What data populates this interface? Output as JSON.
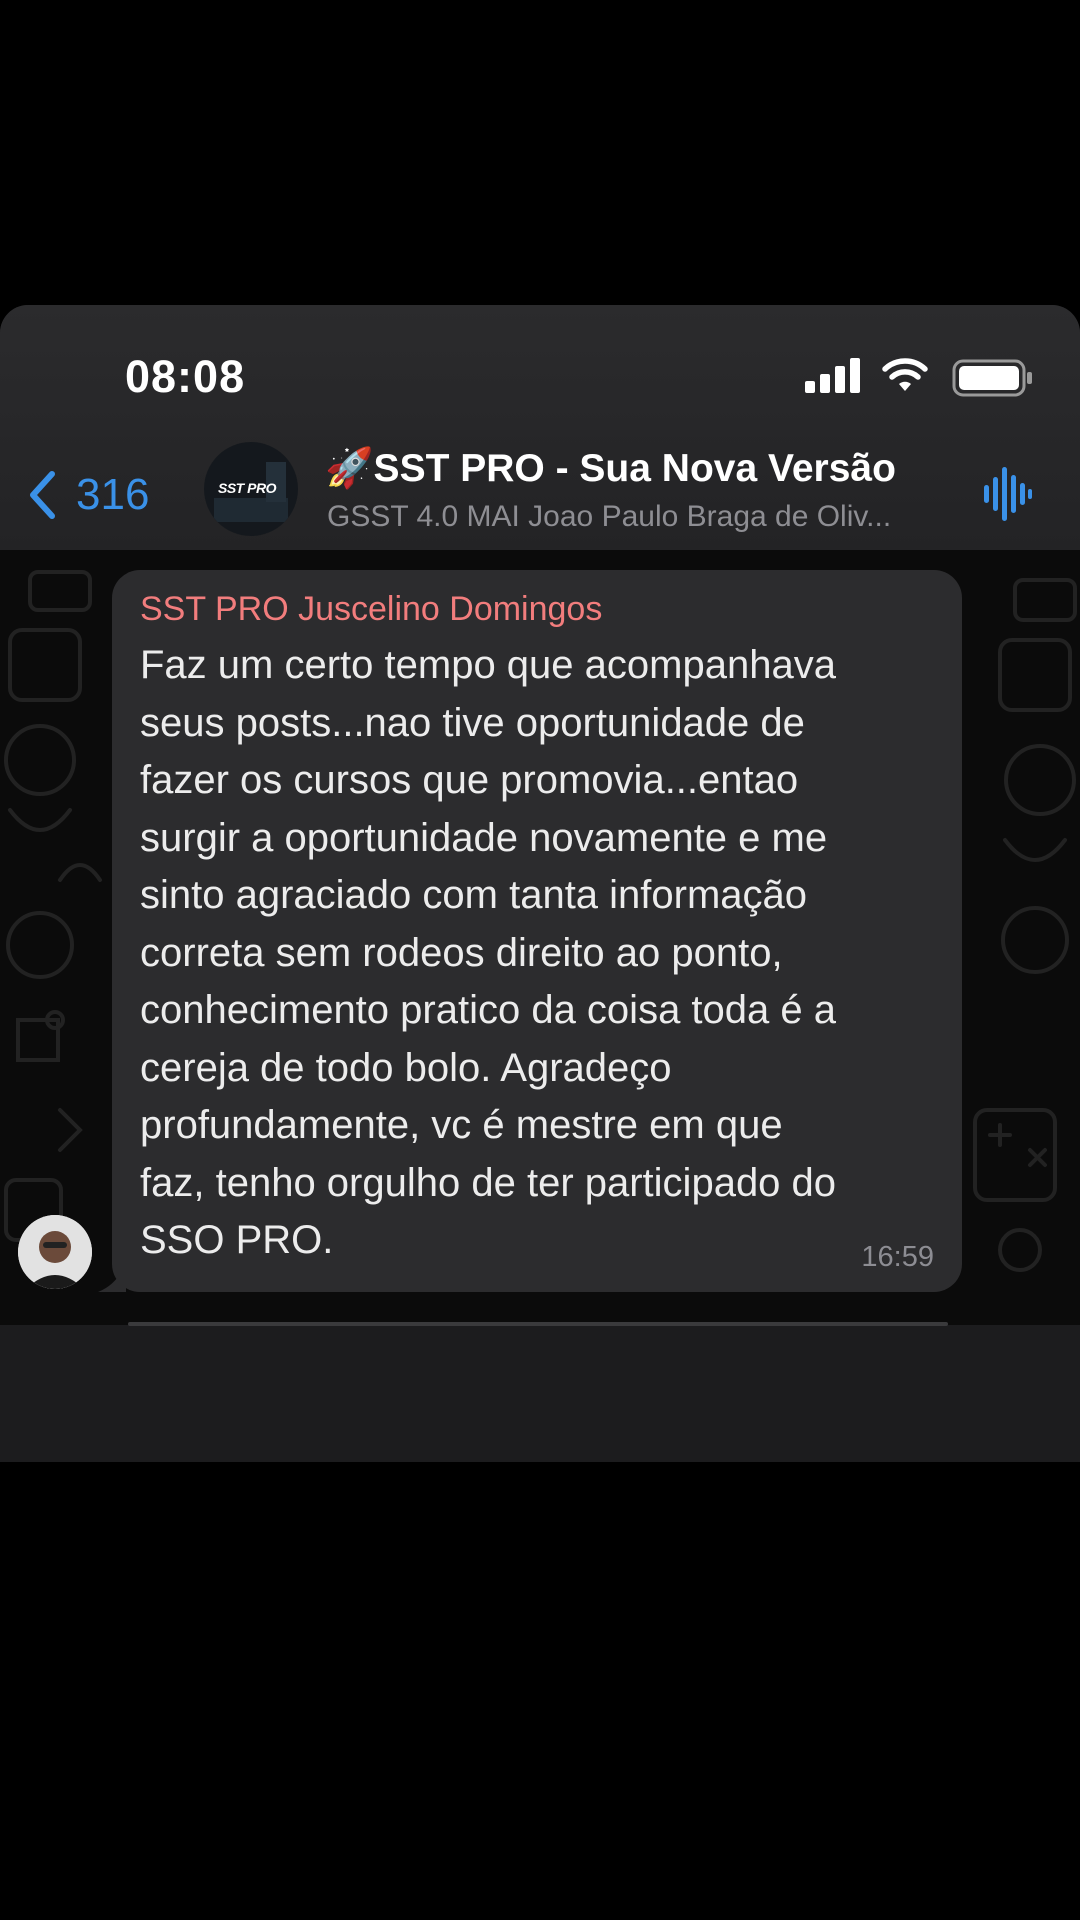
{
  "status_bar": {
    "time": "08:08"
  },
  "nav": {
    "back_count": "316",
    "group_logo_text": "SST PRO",
    "title": "🚀SST PRO - Sua Nova Versão",
    "subtitle": "GSST 4.0 MAI Joao Paulo Braga de Oliv..."
  },
  "message": {
    "sender": "SST PRO Juscelino Domingos",
    "text": "Faz um certo tempo que acompanhava\nseus posts...nao tive oportunidade de\nfazer os cursos que promovia...entao\nsurgir a oportunidade novamente e me\nsinto agraciado com tanta informação\ncorreta sem rodeos direito ao ponto,\nconhecimento pratico da coisa toda é a\ncereja de todo bolo. Agradeço\nprofundamente, vc é mestre em que\nfaz, tenho orgulho de ter participado do\nSSO PRO.",
    "time": "16:59"
  },
  "colors": {
    "accent": "#3a91e8",
    "sender_name": "#f27d7d",
    "bubble": "#2c2c2e",
    "header": "#2b2b2d"
  },
  "icons": [
    "chevron-left-icon",
    "cellular-signal-icon",
    "wifi-icon",
    "battery-icon",
    "audio-waveform-icon"
  ]
}
